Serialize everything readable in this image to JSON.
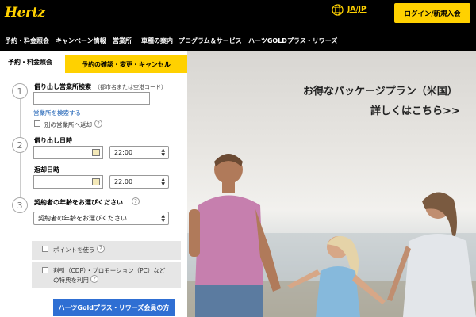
{
  "header": {
    "logo": "Hertz",
    "language": "JA/JP",
    "login_label": "ログイン/新規入会"
  },
  "nav": {
    "items": [
      {
        "label": "予約・料金照会"
      },
      {
        "label": "キャンペーン情報"
      },
      {
        "label": "営業所"
      },
      {
        "label": "車種の案内"
      },
      {
        "label": "プログラム＆サービス"
      },
      {
        "label": "ハーツGOLDプラス・リワーズ"
      }
    ]
  },
  "hero": {
    "title": "お得なパッケージプラン（米国）",
    "link": "詳しくはこちら>>"
  },
  "booking": {
    "tabs": {
      "active": "予約・料金照会",
      "inactive": "予約の確認・変更・キャンセル"
    },
    "steps": [
      "1",
      "2",
      "3"
    ],
    "pickup_location": {
      "label": "借り出し営業所検索",
      "hint": "（都市名または空港コード）",
      "value": "",
      "search_link": "営業所を検索する",
      "return_elsewhere": "別の営業所へ返却"
    },
    "pickup_date": {
      "label": "借り出し日時",
      "date": "",
      "time": "22:00"
    },
    "return_date": {
      "label": "返却日時",
      "date": "",
      "time": "22:00"
    },
    "age": {
      "label": "契約者の年齢をお選びください",
      "selected": "契約者の年齢をお選びください"
    },
    "options": {
      "points": "ポイントを使う",
      "discount_line1": "割引（CDP）・プロモーション（PC）など",
      "discount_line2": "の特典を利用"
    },
    "help_glyph": "?",
    "gold_button": "ハーツGoldプラス・リワーズ会員の方"
  },
  "colors": {
    "brand_yellow": "#ffd100",
    "header_bg": "#000000",
    "link_blue": "#1a5fb4",
    "button_blue": "#2f6fd3"
  }
}
